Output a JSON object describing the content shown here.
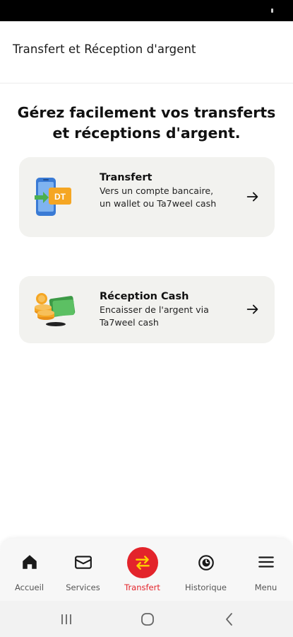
{
  "header": {
    "title": "Transfert et Réception d'argent"
  },
  "headline": "Gérez facilement vos transferts et réceptions d'argent.",
  "cards": [
    {
      "title": "Transfert",
      "description": "Vers un compte bancaire, un wallet ou Ta7weel cash",
      "icon": "phone-dt-transfer-icon",
      "badge": "DT"
    },
    {
      "title": "Réception Cash",
      "description": "Encaisser de l'argent via Ta7weel cash",
      "icon": "coins-cash-icon"
    }
  ],
  "bottom_nav": {
    "items": [
      {
        "label": "Accueil",
        "icon": "home-icon"
      },
      {
        "label": "Services",
        "icon": "wallet-icon"
      },
      {
        "label": "Transfert",
        "icon": "transfer-arrows-icon",
        "active": true
      },
      {
        "label": "Historique",
        "icon": "history-icon"
      },
      {
        "label": "Menu",
        "icon": "hamburger-icon"
      }
    ]
  },
  "colors": {
    "accent": "#e3242b",
    "card_bg": "#f2f2ef"
  }
}
